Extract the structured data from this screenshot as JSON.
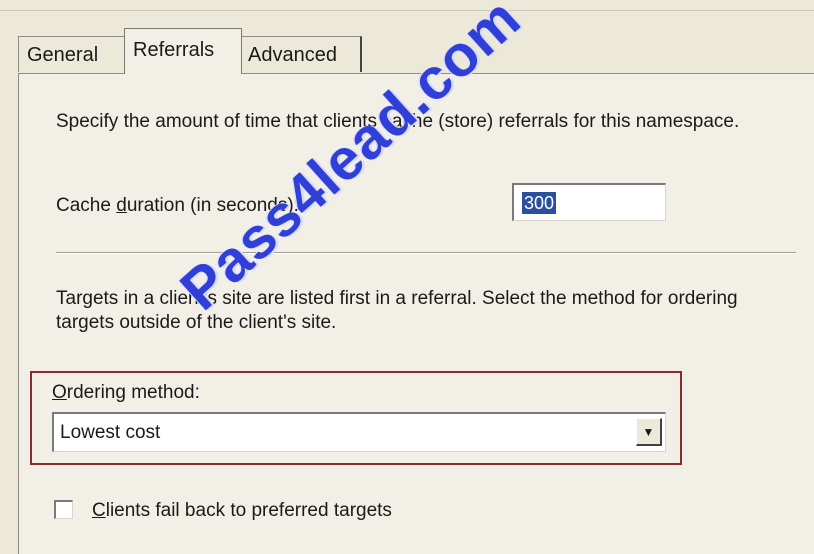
{
  "tabs": {
    "general": "General",
    "referrals": "Referrals",
    "advanced": "Advanced"
  },
  "referrals": {
    "description": "Specify the amount of time that clients cache (store) referrals for this namespace.",
    "cache_label_pre": "Cac",
    "cache_label_h": "h",
    "cache_label_mid": "e ",
    "cache_label_u": "d",
    "cache_label_post": "uration (in seconds):",
    "cache_value": "300",
    "ordering_description": "Targets in a client's site are listed first in a referral. Select the method for ordering targets outside of the client's site.",
    "ordering_label_u": "O",
    "ordering_label_rest": "rdering method:",
    "ordering_value": "Lowest cost",
    "failback_label_u": "C",
    "failback_label_rest": "lients fail back to preferred targets",
    "failback_checked": false
  },
  "watermark": "Pass4lead.com",
  "icons": {
    "dropdown": "chevron-down-icon"
  }
}
